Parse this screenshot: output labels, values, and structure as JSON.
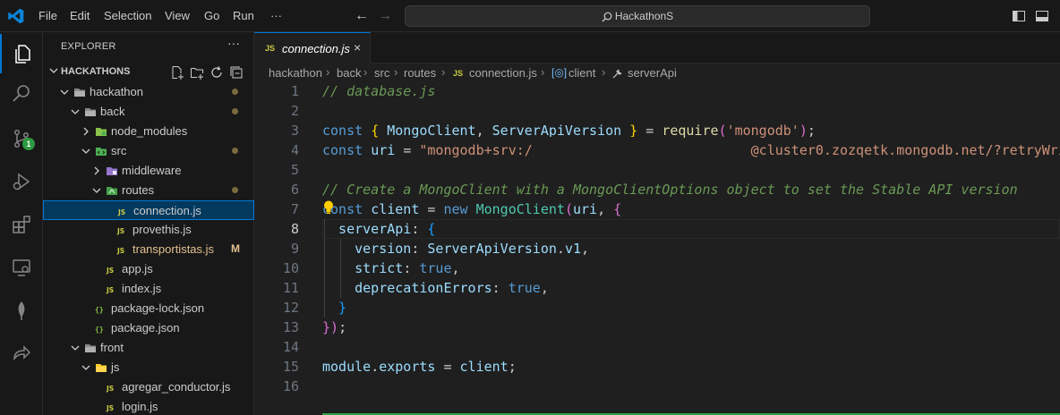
{
  "menu": [
    "File",
    "Edit",
    "Selection",
    "View",
    "Go",
    "Run",
    "···"
  ],
  "command_center": "HackathonS",
  "activity_bar": {
    "items": [
      "explorer-icon",
      "search-icon",
      "source-control-icon",
      "run-debug-icon",
      "extensions-icon",
      "remote-explorer-icon",
      "mongodb-icon",
      "live-share-icon"
    ],
    "scm_badge": "1"
  },
  "explorer": {
    "title": "EXPLORER",
    "more": "···",
    "root": "HACKATHONS",
    "tree": [
      {
        "label": "hackathon",
        "depth": 1,
        "kind": "folder",
        "open": true,
        "dot": true
      },
      {
        "label": "back",
        "depth": 2,
        "kind": "folder",
        "open": true,
        "dot": true
      },
      {
        "label": "node_modules",
        "depth": 3,
        "kind": "node-folder",
        "open": false
      },
      {
        "label": "src",
        "depth": 3,
        "kind": "src-folder",
        "open": true,
        "dot": true
      },
      {
        "label": "middleware",
        "depth": 4,
        "kind": "mw-folder",
        "open": false
      },
      {
        "label": "routes",
        "depth": 4,
        "kind": "routes-folder",
        "open": true,
        "dot": true
      },
      {
        "label": "connection.js",
        "depth": 5,
        "kind": "js",
        "selected": true
      },
      {
        "label": "provethis.js",
        "depth": 5,
        "kind": "js"
      },
      {
        "label": "transportistas.js",
        "depth": 5,
        "kind": "js",
        "modified": true,
        "status": "M"
      },
      {
        "label": "app.js",
        "depth": 4,
        "kind": "js"
      },
      {
        "label": "index.js",
        "depth": 4,
        "kind": "js"
      },
      {
        "label": "package-lock.json",
        "depth": 3,
        "kind": "json"
      },
      {
        "label": "package.json",
        "depth": 3,
        "kind": "json"
      },
      {
        "label": "front",
        "depth": 2,
        "kind": "folder",
        "open": true
      },
      {
        "label": "js",
        "depth": 3,
        "kind": "js-folder",
        "open": true
      },
      {
        "label": "agregar_conductor.js",
        "depth": 4,
        "kind": "js"
      },
      {
        "label": "login.js",
        "depth": 4,
        "kind": "js"
      }
    ]
  },
  "tab": {
    "label": "connection.js",
    "icon": "JS",
    "close": "×"
  },
  "breadcrumb": [
    "hackathon",
    "back",
    "src",
    "routes",
    "connection.js",
    "client",
    "serverApi"
  ],
  "editor": {
    "current_line": 8,
    "lines": [
      [
        [
          "// database.js",
          "comment"
        ]
      ],
      [],
      [
        [
          "const ",
          "kw"
        ],
        [
          "{ ",
          "brace"
        ],
        [
          "MongoClient",
          "var"
        ],
        [
          ", ",
          "plain"
        ],
        [
          "ServerApiVersion",
          "var"
        ],
        [
          " } ",
          "brace"
        ],
        [
          "= ",
          "plain"
        ],
        [
          "require",
          "fn"
        ],
        [
          "(",
          "paren"
        ],
        [
          "'mongodb'",
          "str"
        ],
        [
          ")",
          "paren"
        ],
        [
          ";",
          "plain"
        ]
      ],
      [
        [
          "const ",
          "kw"
        ],
        [
          "uri ",
          "var"
        ],
        [
          "= ",
          "plain"
        ],
        [
          "\"mongodb+srv://ALTF4:",
          "str"
        ],
        [
          "                    ",
          "plain"
        ],
        [
          "@cluster0.zozqetk.mongodb.net/?retryWri",
          "str"
        ]
      ],
      [],
      [
        [
          "// Create a MongoClient with a MongoClientOptions object to set the Stable API version",
          "comment"
        ]
      ],
      [
        [
          "const ",
          "kw"
        ],
        [
          "client ",
          "var"
        ],
        [
          "= ",
          "plain"
        ],
        [
          "new ",
          "kw"
        ],
        [
          "MongoClient",
          "cls"
        ],
        [
          "(",
          "paren"
        ],
        [
          "uri",
          "var"
        ],
        [
          ", ",
          "plain"
        ],
        [
          "{",
          "brace2"
        ]
      ],
      [
        [
          "  serverApi",
          "prop"
        ],
        [
          ": ",
          "plain"
        ],
        [
          "{",
          "brace3"
        ]
      ],
      [
        [
          "    version",
          "prop"
        ],
        [
          ": ",
          "plain"
        ],
        [
          "ServerApiVersion",
          "var"
        ],
        [
          ".",
          "plain"
        ],
        [
          "v1",
          "prop"
        ],
        [
          ",",
          "plain"
        ]
      ],
      [
        [
          "    strict",
          "prop"
        ],
        [
          ": ",
          "plain"
        ],
        [
          "true",
          "bool"
        ],
        [
          ",",
          "plain"
        ]
      ],
      [
        [
          "    deprecationErrors",
          "prop"
        ],
        [
          ": ",
          "plain"
        ],
        [
          "true",
          "bool"
        ],
        [
          ",",
          "plain"
        ]
      ],
      [
        [
          "  }",
          "brace3"
        ]
      ],
      [
        [
          "}",
          "brace2"
        ],
        [
          ")",
          "paren"
        ],
        [
          ";",
          "plain"
        ]
      ],
      [],
      [
        [
          "module",
          "var"
        ],
        [
          ".",
          "plain"
        ],
        [
          "exports ",
          "prop"
        ],
        [
          "= ",
          "plain"
        ],
        [
          "client",
          "var"
        ],
        [
          ";",
          "plain"
        ]
      ],
      []
    ]
  },
  "colors": {
    "accent": "#0078d4",
    "comment": "#6a9955",
    "keyword": "#569cd6",
    "string": "#ce9178",
    "variable": "#9cdcfe",
    "function": "#dcdcaa",
    "class": "#4ec9b0",
    "brace_gold": "#ffd700",
    "brace_pink": "#da70d6",
    "brace_blue": "#179fff",
    "modified": "#e2c08d"
  }
}
